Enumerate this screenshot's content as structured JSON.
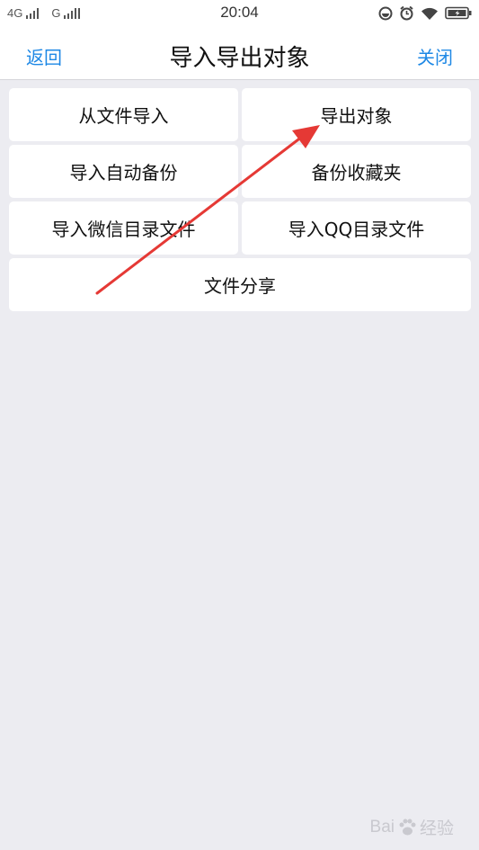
{
  "status_bar": {
    "network1": "4G",
    "network2": "G",
    "time": "20:04"
  },
  "nav": {
    "back_label": "返回",
    "title": "导入导出对象",
    "close_label": "关闭"
  },
  "menu": {
    "items": [
      {
        "label": "从文件导入"
      },
      {
        "label": "导出对象"
      },
      {
        "label": "导入自动备份"
      },
      {
        "label": "备份收藏夹"
      },
      {
        "label": "导入微信目录文件"
      },
      {
        "label": "导入QQ目录文件"
      },
      {
        "label": "文件分享"
      }
    ]
  },
  "annotation": {
    "color": "#e53935",
    "icon": "red-arrow"
  },
  "watermark": {
    "text1": "Bai",
    "text2": "经验"
  }
}
